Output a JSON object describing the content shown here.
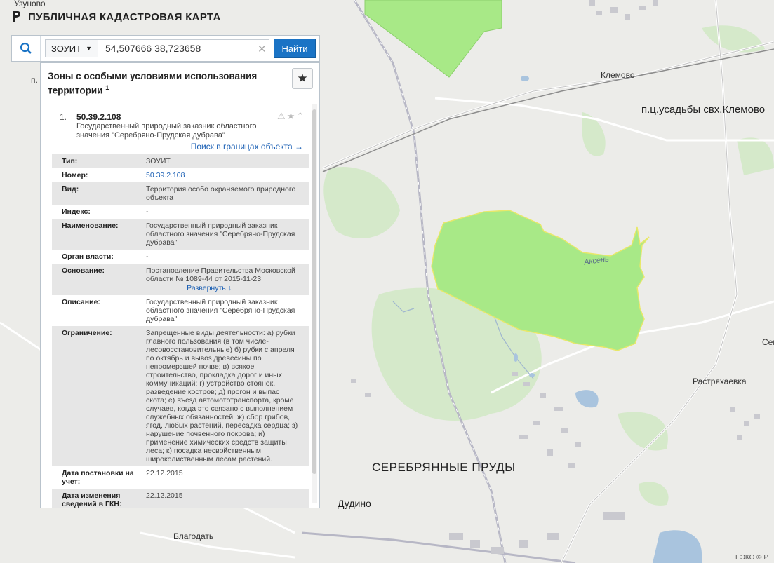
{
  "app": {
    "title": "ПУБЛИЧНАЯ КАДАСТРОВАЯ КАРТА",
    "logo_icon": "cadastral-logo-icon"
  },
  "search": {
    "icon": "search-icon",
    "category": "ЗОУИТ",
    "category_icon": "caret-down-icon",
    "query": "54,507666 38,723658",
    "clear_icon": "clear-icon",
    "find_label": "Найти"
  },
  "panel": {
    "title": "Зоны с особыми условиями использования территории",
    "title_sup": "1",
    "favorite_icon": "star-icon",
    "result": {
      "index": "1.",
      "number": "50.39.2.108",
      "description": "Государственный природный заказник областного значения \"Серебряно-Прудская дубрава\"",
      "search_link": "Поиск в границах объекта →"
    },
    "properties": [
      {
        "key": "Тип:",
        "value": "ЗОУИТ"
      },
      {
        "key": "Номер:",
        "value": "50.39.2.108",
        "link": true
      },
      {
        "key": "Вид:",
        "value": "Территория особо охраняемого природного объекта"
      },
      {
        "key": "Индекс:",
        "value": "-"
      },
      {
        "key": "Наименование:",
        "value": "Государственный природный заказник областного значения \"Серебряно-Прудская дубрава\""
      },
      {
        "key": "Орган власти:",
        "value": "-"
      },
      {
        "key": "Основание:",
        "value": "Постановление Правительства Московской области № 1089-44 от 2015-11-23",
        "expand": "Развернуть ↓"
      },
      {
        "key": "Описание:",
        "value": "Государственный природный заказник областного значения \"Серебряно-Прудская дубрава\""
      },
      {
        "key": "Ограничение:",
        "value": "Запрещенные виды деятельности: а) рубки главного пользования (в том числе-лесовосстановительные) б) рубки с апреля по октябрь и вывоз древесины по непромерзшей почве; в) всякое строительство, прокладка дорог и иных коммуникаций; г) устройство стоянок, разведение костров; д) прогон и выпас скота; е) въезд автомототранспорта, кроме случаев, когда это связано с выполнением служебных обязанностей. ж) сбор грибов, ягод, любых растений, пересадка сердца; з) нарушение почвенного покрова; и) применение химических средств защиты леса; к) посадка несвойственным широколиственным лесам растений."
      },
      {
        "key": "Дата постановки на учет:",
        "value": "22.12.2015"
      },
      {
        "key": "Дата изменения сведений в ГКН:",
        "value": "22.12.2015"
      }
    ]
  },
  "map": {
    "labels": {
      "uzunovo": "Узуново",
      "p_left": "п.",
      "klemovo": "Клемово",
      "usadba": "п.ц.усадьбы свх.Клемово",
      "aksen": "Аксень",
      "sem": "Сем",
      "rastryakhaevka": "Растряхаевка",
      "serebryanye_prudy": "СЕРЕБРЯННЫЕ ПРУДЫ",
      "dudino": "Дудино",
      "blagodat": "Благодать"
    },
    "zone_color": "#a8e987",
    "zone_border": "#e8e86a",
    "forest_color": "#d2e9c3"
  },
  "watermark": "ЕЭКО © Р"
}
